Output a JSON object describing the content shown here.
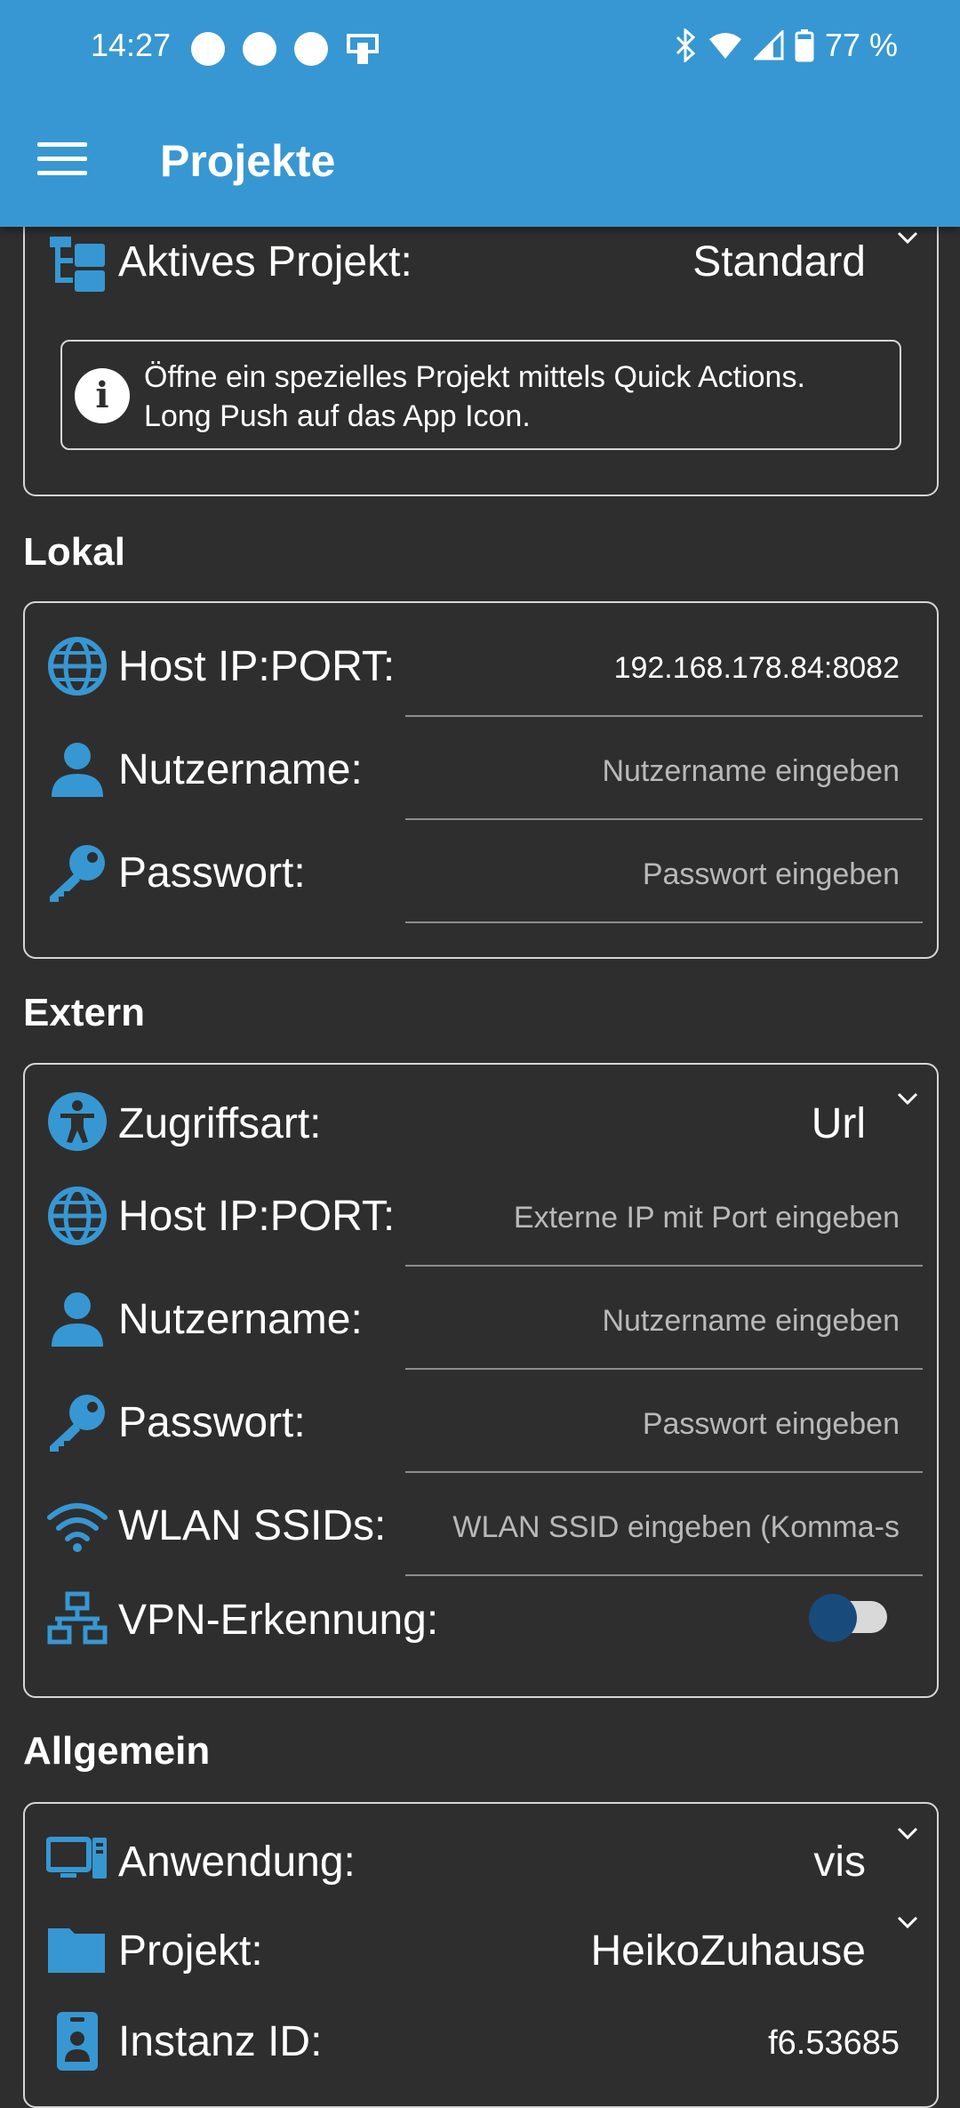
{
  "status_bar": {
    "time": "14:27",
    "battery": "77 %"
  },
  "app_bar": {
    "title": "Projekte"
  },
  "active_project": {
    "label": "Aktives Projekt:",
    "value": "Standard",
    "info_text_line1": "Öffne ein spezielles Projekt mittels Quick Actions.",
    "info_text_line2": "Long Push auf das App Icon."
  },
  "lokal": {
    "title": "Lokal",
    "host_label": "Host IP:PORT:",
    "host_value": "192.168.178.84:8082",
    "user_label": "Nutzername:",
    "user_placeholder": "Nutzername eingeben",
    "pass_label": "Passwort:",
    "pass_placeholder": "Passwort eingeben"
  },
  "extern": {
    "title": "Extern",
    "access_label": "Zugriffsart:",
    "access_value": "Url",
    "host_label": "Host IP:PORT:",
    "host_placeholder": "Externe IP mit Port eingeben",
    "user_label": "Nutzername:",
    "user_placeholder": "Nutzername eingeben",
    "pass_label": "Passwort:",
    "pass_placeholder": "Passwort eingeben",
    "ssid_label": "WLAN SSIDs:",
    "ssid_placeholder": "WLAN SSID eingeben (Komma-s",
    "vpn_label": "VPN-Erkennung:"
  },
  "allgemein": {
    "title": "Allgemein",
    "app_label": "Anwendung:",
    "app_value": "vis",
    "project_label": "Projekt:",
    "project_value": "HeikoZuhause",
    "instance_label": "Instanz ID:",
    "instance_value": "f6.53685"
  },
  "colors": {
    "accent": "#3797d2",
    "background": "#2e2e2e",
    "icon": "#3797d2",
    "toggle_thumb": "#194a7c"
  }
}
